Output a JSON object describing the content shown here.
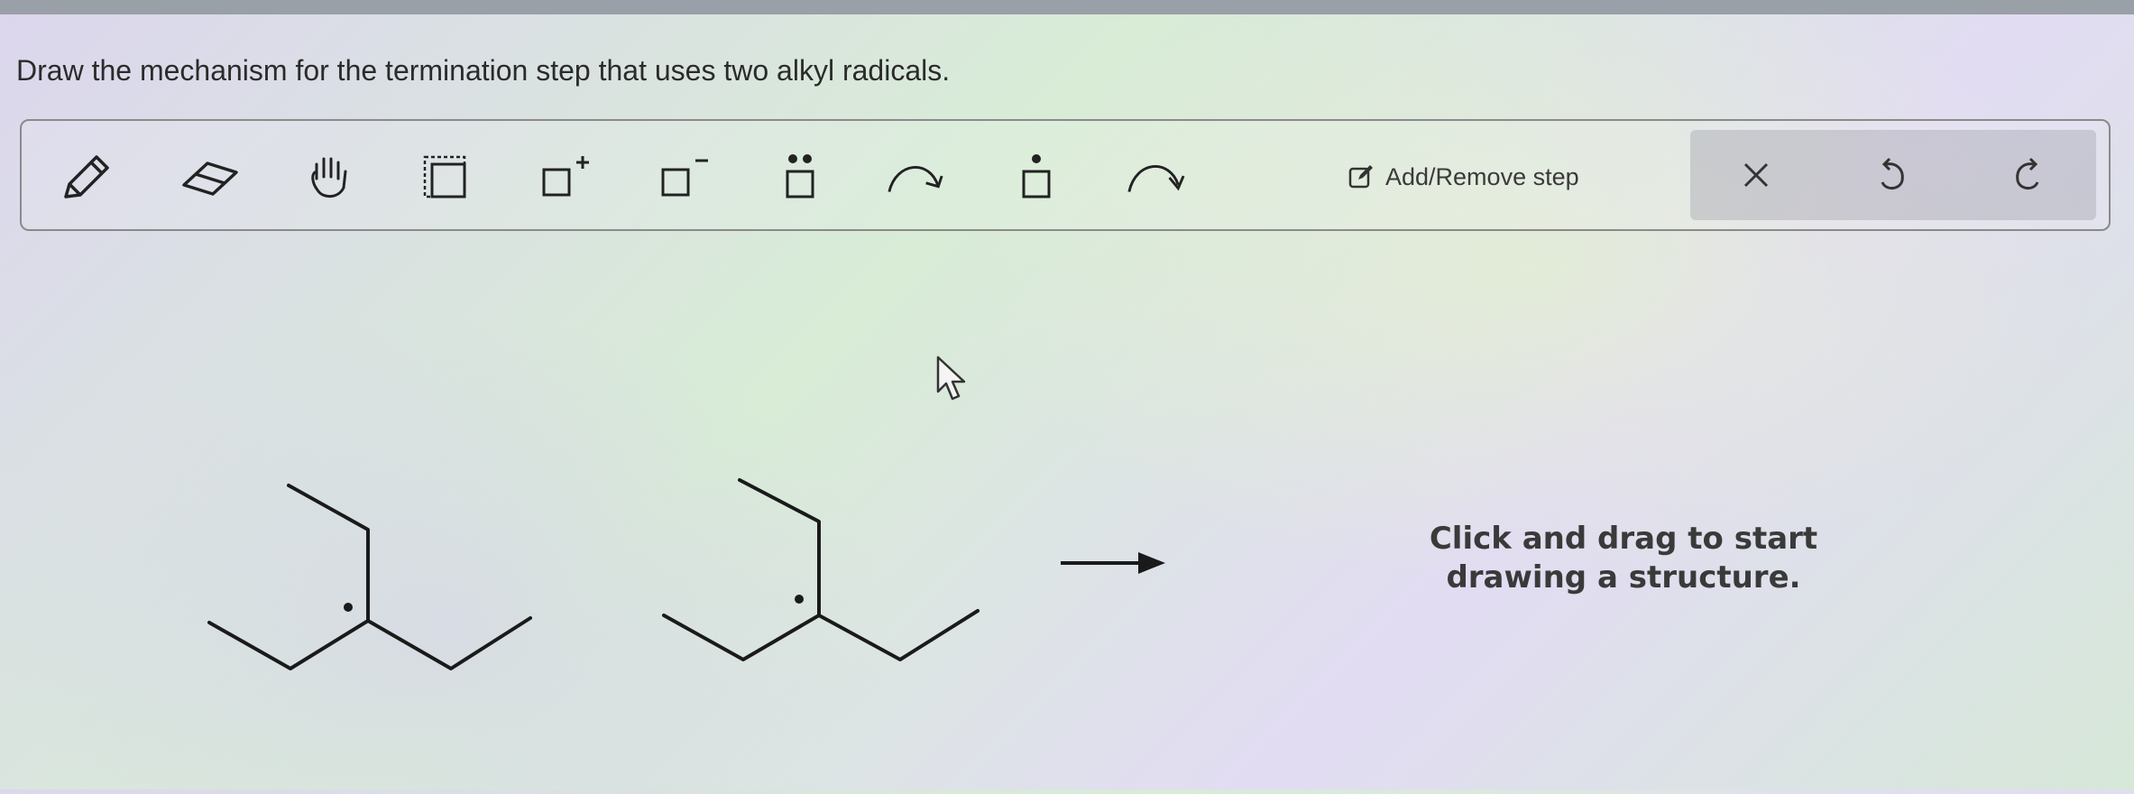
{
  "question": "Draw the mechanism for the termination step that uses two alkyl radicals.",
  "toolbar": {
    "tools": [
      {
        "name": "pencil-tool",
        "icon": "pencil-icon"
      },
      {
        "name": "eraser-tool",
        "icon": "eraser-icon"
      },
      {
        "name": "hand-tool",
        "icon": "hand-icon"
      },
      {
        "name": "select-tool",
        "icon": "selection-box-icon"
      },
      {
        "name": "positive-charge-tool",
        "icon": "positive-charge-icon"
      },
      {
        "name": "negative-charge-tool",
        "icon": "negative-charge-icon"
      },
      {
        "name": "lone-pair-tool",
        "icon": "lone-pair-icon"
      },
      {
        "name": "single-electron-arrow-tool",
        "icon": "fishhook-arrow-icon"
      },
      {
        "name": "radical-tool",
        "icon": "radical-dot-icon"
      },
      {
        "name": "electron-pair-arrow-tool",
        "icon": "curved-arrow-icon"
      }
    ],
    "add_remove_label": "Add/Remove step",
    "actions": [
      "close-icon",
      "undo-icon",
      "redo-icon"
    ]
  },
  "canvas": {
    "hint_line1": "Click and drag to start",
    "hint_line2": "drawing a structure."
  },
  "colors": {
    "ink": "#1a1a1a",
    "text": "#3a3a3a",
    "toolbar_border": "#8a8a8a"
  }
}
